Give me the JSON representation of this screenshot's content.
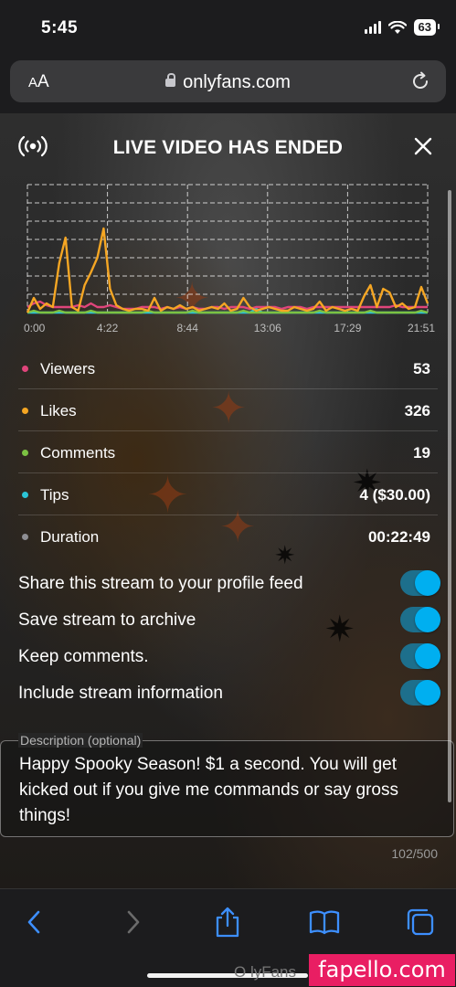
{
  "status_bar": {
    "time": "5:45",
    "battery": "63"
  },
  "browser": {
    "aa_small": "A",
    "aa_large": "A",
    "domain": "onlyfans.com"
  },
  "modal": {
    "title": "LIVE VIDEO HAS ENDED"
  },
  "chart_data": {
    "type": "line",
    "x_tick_labels": [
      "0:00",
      "4:22",
      "8:44",
      "13:06",
      "17:29",
      "21:51"
    ],
    "ylim": [
      0,
      7
    ],
    "grid": true,
    "series": [
      {
        "name": "Likes",
        "color": "#f5a623",
        "values": [
          0,
          0.8,
          0.2,
          0.5,
          0.3,
          2.7,
          4.1,
          0.3,
          0.1,
          1.5,
          2.2,
          3.0,
          4.6,
          1.3,
          0.4,
          0.2,
          0.1,
          0.2,
          0.2,
          0.1,
          0.8,
          0.1,
          0.3,
          0.2,
          0.4,
          0.2,
          0.3,
          0.1,
          0.2,
          0.3,
          0.2,
          0.5,
          0.1,
          0.2,
          0.8,
          0.3,
          0.1,
          0.2,
          0.3,
          0.2,
          0.1,
          0.1,
          0.3,
          0.2,
          0.1,
          0.2,
          0.6,
          0.1,
          0.3,
          0.2,
          0.1,
          0.2,
          0.1,
          0.9,
          1.5,
          0.3,
          1.3,
          1.1,
          0.3,
          0.5,
          0.2,
          0.3,
          1.4,
          0.5
        ]
      },
      {
        "name": "Viewers",
        "color": "#e0457b",
        "values": [
          0.3,
          0.5,
          0.6,
          0.4,
          0.3,
          0.3,
          0.3,
          0.3,
          0.4,
          0.3,
          0.5,
          0.3,
          0.3,
          0.4,
          0.3,
          0.2,
          0.2,
          0.2,
          0.3,
          0.3,
          0.3,
          0.2,
          0.3,
          0.2,
          0.3,
          0.2,
          0.3,
          0.2,
          0.2,
          0.3,
          0.3,
          0.2,
          0.3,
          0.3,
          0.3,
          0.2,
          0.3,
          0.3,
          0.3,
          0.3,
          0.2,
          0.3,
          0.3,
          0.3,
          0.2,
          0.3,
          0.3,
          0.3,
          0.3,
          0.3,
          0.3,
          0.3,
          0.3,
          0.3,
          0.3,
          0.3,
          0.3,
          0.3,
          0.4,
          0.3,
          0.3,
          0.3,
          0.3,
          0.3
        ]
      },
      {
        "name": "Comments",
        "color": "#7cc242",
        "values": [
          0,
          0.1,
          0,
          0,
          0,
          0.1,
          0,
          0,
          0,
          0,
          0.1,
          0,
          0,
          0,
          0,
          0,
          0,
          0,
          0,
          0.1,
          0,
          0,
          0,
          0,
          0,
          0,
          0.1,
          0,
          0,
          0,
          0,
          0,
          0,
          0,
          0.1,
          0,
          0,
          0,
          0,
          0,
          0,
          0,
          0,
          0,
          0,
          0,
          0.1,
          0,
          0,
          0,
          0,
          0,
          0,
          0,
          0.1,
          0,
          0,
          0,
          0,
          0,
          0,
          0,
          0.1,
          0
        ]
      },
      {
        "name": "Tips",
        "color": "#2bc4d6",
        "values": [
          0,
          0,
          0,
          0,
          0,
          0,
          0,
          0,
          0,
          0,
          0,
          0,
          0,
          0,
          0,
          0,
          0,
          0,
          0,
          0,
          0,
          0,
          0,
          0,
          0,
          0,
          0,
          0,
          0,
          0,
          0,
          0,
          0,
          0,
          0,
          0,
          0.2,
          0,
          0,
          0,
          0,
          0,
          0,
          0,
          0,
          0,
          0,
          0,
          0,
          0,
          0,
          0,
          0,
          0,
          0,
          0,
          0,
          0,
          0,
          0,
          0,
          0,
          0,
          0
        ]
      }
    ]
  },
  "stats": [
    {
      "label": "Viewers",
      "value": "53",
      "color": "#e0457b"
    },
    {
      "label": "Likes",
      "value": "326",
      "color": "#f5a623"
    },
    {
      "label": "Comments",
      "value": "19",
      "color": "#7cc242"
    },
    {
      "label": "Tips",
      "value": "4 ($30.00)",
      "color": "#2bc4d6"
    },
    {
      "label": "Duration",
      "value": "00:22:49",
      "color": "#8e8e93"
    }
  ],
  "toggles": [
    {
      "label": "Share this stream to your profile feed",
      "on": true
    },
    {
      "label": "Save stream to archive",
      "on": true
    },
    {
      "label": "Keep comments.",
      "on": true
    },
    {
      "label": "Include stream information",
      "on": true
    }
  ],
  "description": {
    "legend": "Description (optional)",
    "text": "Happy Spooky Season! $1 a second. You will get kicked out if you give me commands or say gross things!",
    "count": "102/500"
  },
  "footer": {
    "under_text": "O lyFans",
    "watermark": "fapello.com"
  }
}
